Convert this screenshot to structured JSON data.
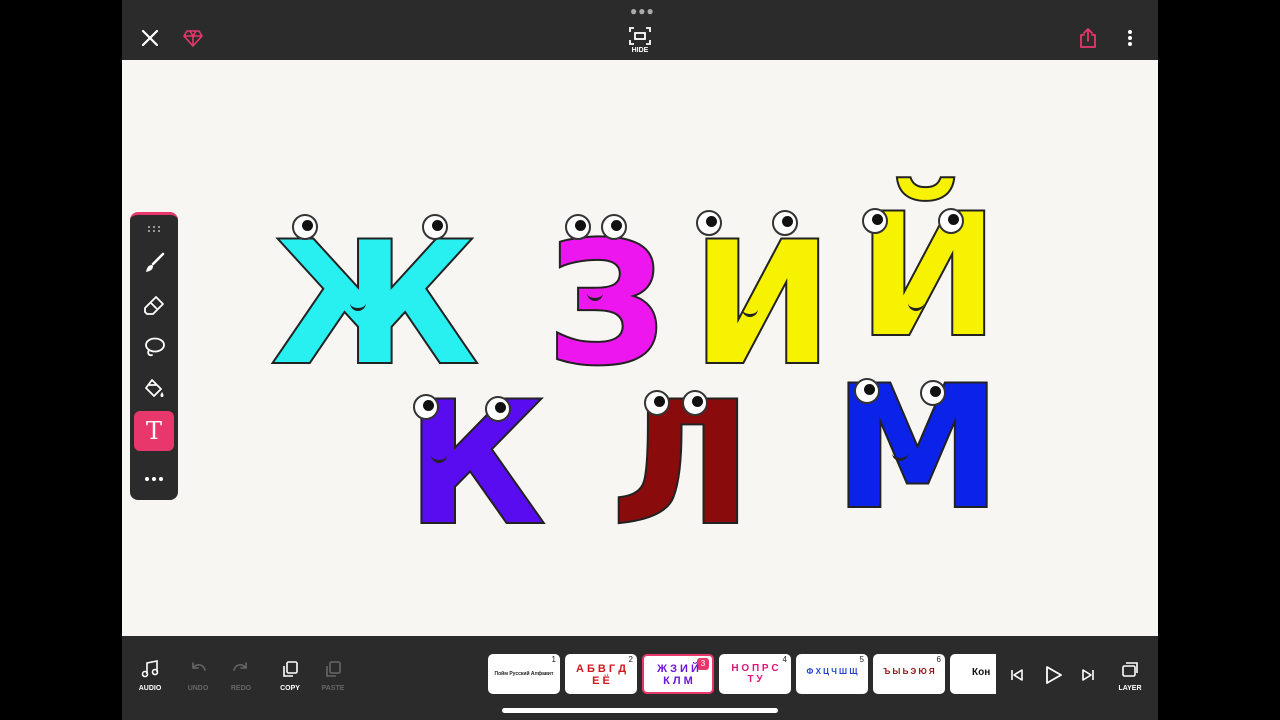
{
  "header": {
    "hide_label": "HIDE"
  },
  "canvas": {
    "letters": [
      {
        "char": "Ж",
        "color": "#29f0f0"
      },
      {
        "char": "З",
        "color": "#ee16ee"
      },
      {
        "char": "И",
        "color": "#f7f200"
      },
      {
        "char": "Й",
        "color": "#f7f200"
      },
      {
        "char": "К",
        "color": "#5a0cf0"
      },
      {
        "char": "Л",
        "color": "#8a0b0b"
      },
      {
        "char": "М",
        "color": "#0b22e8"
      }
    ]
  },
  "tools": {
    "handle": "grip-icon",
    "brush": "brush-icon",
    "eraser": "eraser-icon",
    "lasso": "lasso-icon",
    "fill": "fill-bucket-icon",
    "text": "T",
    "more": "more-icon"
  },
  "bottom": {
    "audio": "AUDIO",
    "undo": "UNDO",
    "redo": "REDO",
    "copy": "COPY",
    "paste": "PASTE",
    "layer": "LAYER"
  },
  "frames": [
    {
      "num": "1",
      "text": "Пойм Русский Алфавит"
    },
    {
      "num": "2",
      "text": "А Б В Г Д Е Ё"
    },
    {
      "num": "3",
      "text": "Ж З И Й К Л М"
    },
    {
      "num": "4",
      "text": "Н О П Р С Т У"
    },
    {
      "num": "5",
      "text": "Ф Х Ц Ч Ш Щ"
    },
    {
      "num": "6",
      "text": "Ъ Ы Ь Э Ю Я"
    },
    {
      "num": "",
      "text": "Кон"
    }
  ],
  "colors": {
    "accent": "#e8386b",
    "bar": "#2b2b2b"
  }
}
